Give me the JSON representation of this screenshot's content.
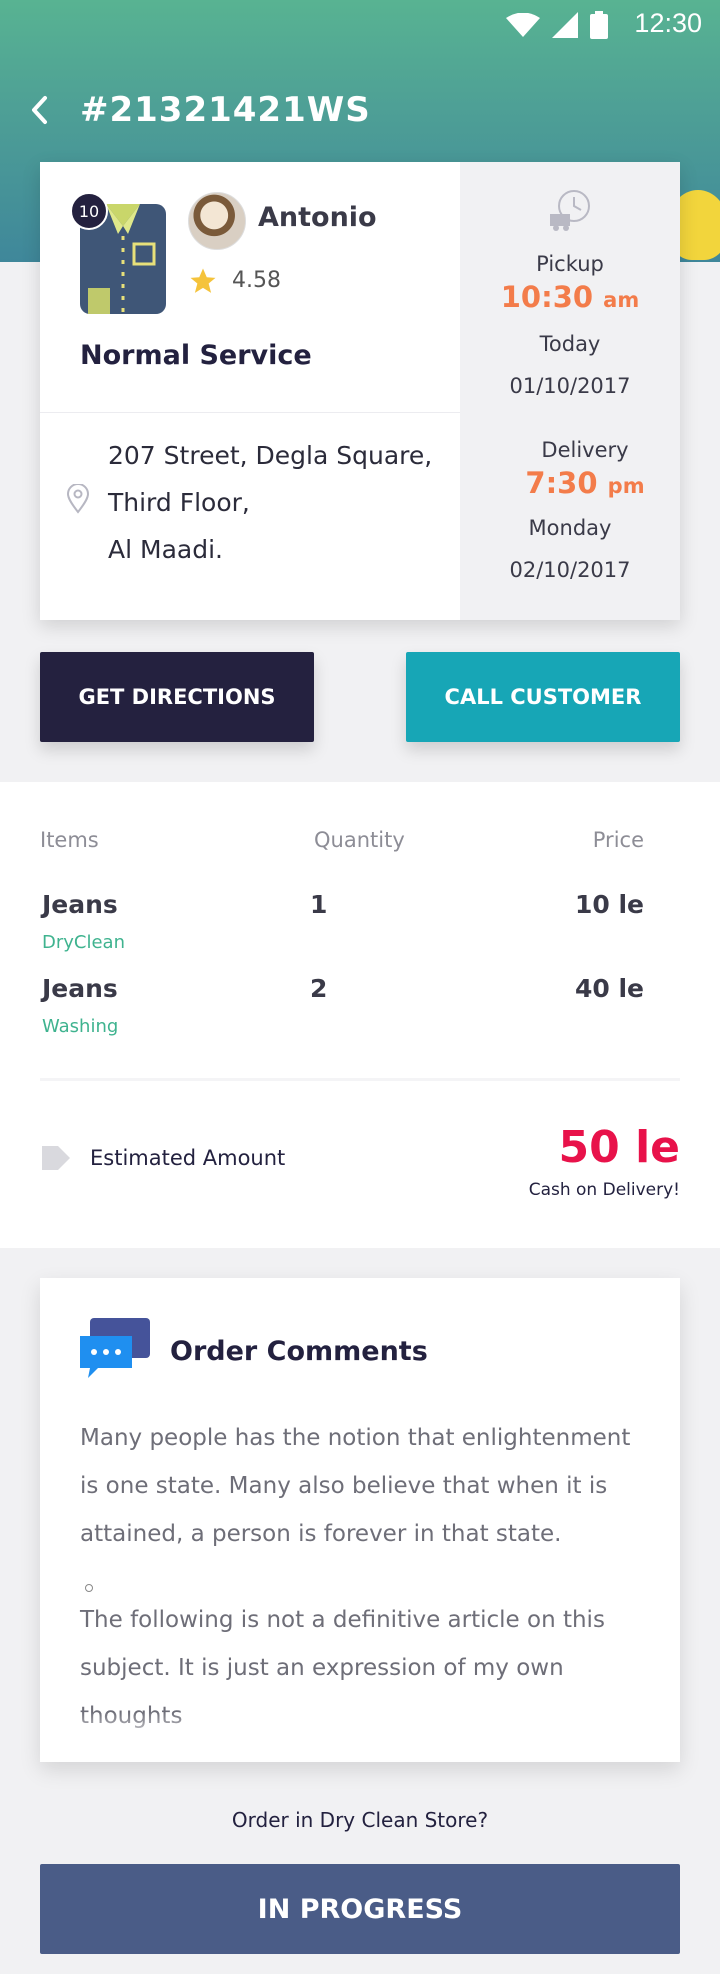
{
  "status_bar": {
    "time": "12:30"
  },
  "header": {
    "order_id": "#21321421WS"
  },
  "order": {
    "item_count": "10",
    "customer": {
      "name": "Antonio",
      "rating": "4.58"
    },
    "service": "Normal Service",
    "address": {
      "line1": "207 Street, Degla Square,",
      "line2": "Third Floor,",
      "line3": "Al Maadi."
    },
    "pickup": {
      "label": "Pickup",
      "time": "10:30",
      "ampm": "am",
      "day": "Today",
      "date": "01/10/2017"
    },
    "delivery": {
      "label": "Delivery",
      "time": "7:30",
      "ampm": "pm",
      "day": "Monday",
      "date": "02/10/2017"
    }
  },
  "actions": {
    "directions": "GET DIRECTIONS",
    "call": "CALL CUSTOMER"
  },
  "items_table": {
    "headers": {
      "items": "Items",
      "quantity": "Quantity",
      "price": "Price"
    },
    "rows": [
      {
        "name": "Jeans",
        "type": "DryClean",
        "qty": "1",
        "price": "10 le"
      },
      {
        "name": "Jeans",
        "type": "Washing",
        "qty": "2",
        "price": "40 le"
      }
    ]
  },
  "estimate": {
    "label": "Estimated Amount",
    "amount": "50 le",
    "note": "Cash on Delivery!"
  },
  "comments": {
    "title": "Order Comments",
    "p1_l1": "Many people has the notion that enlightenment",
    "p1_l2": "is one state. Many also believe that when it is",
    "p1_l3": "attained, a person is forever in that state.",
    "p2_l1": "The following is not a definitive article on this",
    "p2_l2": "subject. It is just an expression of my own",
    "p2_l3": "thoughts"
  },
  "footer": {
    "question": "Order in Dry Clean Store?",
    "status_button": "IN PROGRESS"
  },
  "colors": {
    "primary_dark": "#24213f",
    "teal": "#17a6b6",
    "orange": "#f37c4a",
    "red": "#e8124a",
    "green": "#3fb38f",
    "status_blue": "#4a5c87"
  },
  "icons": [
    "wifi-icon",
    "signal-icon",
    "battery-icon",
    "back-arrow-icon",
    "shirt-icon",
    "star-icon",
    "location-pin-icon",
    "delivery-clock-icon",
    "tag-icon",
    "chat-bubbles-icon"
  ]
}
